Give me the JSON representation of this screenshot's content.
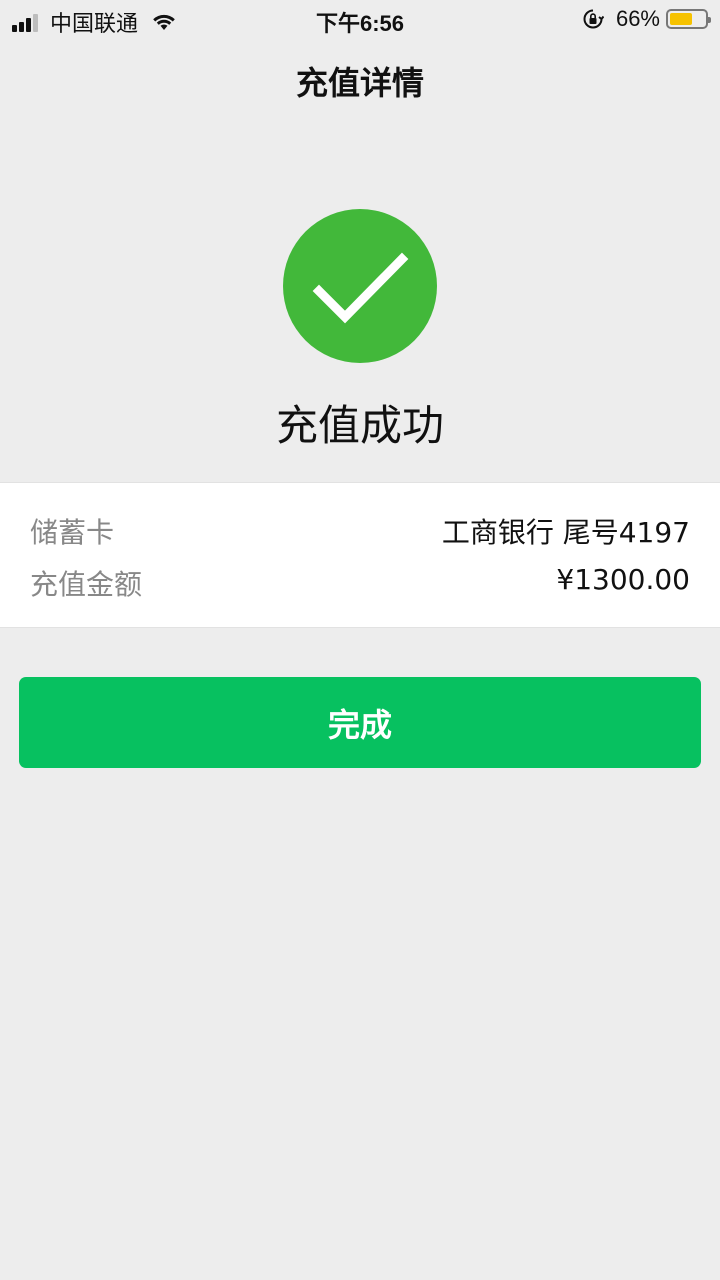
{
  "status_bar": {
    "carrier": "中国联通",
    "time": "下午6:56",
    "battery_percent": "66%",
    "battery_level": 0.66,
    "icons": {
      "signal": "signal-bars-icon",
      "wifi": "wifi-icon",
      "rotation_lock": "rotation-lock-icon",
      "battery": "battery-icon"
    }
  },
  "header": {
    "title": "充值详情"
  },
  "result": {
    "icon": "success-check-icon",
    "icon_color": "#42b83a",
    "message": "充值成功"
  },
  "details": [
    {
      "label": "储蓄卡",
      "value": "工商银行 尾号4197"
    },
    {
      "label": "充值金额",
      "value": "¥1300.00"
    }
  ],
  "actions": {
    "done_label": "完成",
    "done_color": "#07c160"
  }
}
